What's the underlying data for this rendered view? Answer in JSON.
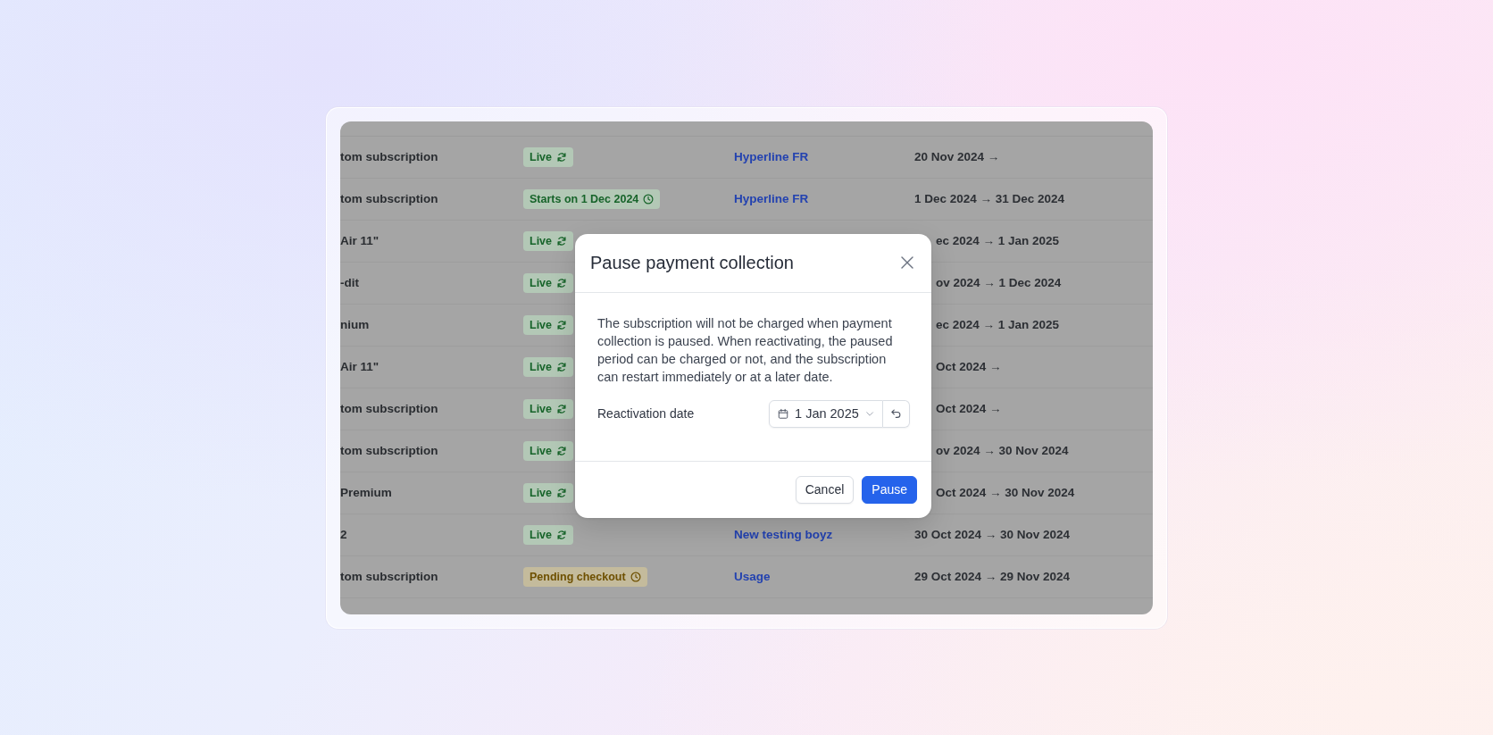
{
  "subscriptions_table": {
    "rows": [
      {
        "column_1": "tom subscription",
        "column_2": {
          "label": "Live",
          "kind": "live"
        },
        "column_3": "Hyperline FR",
        "column_4": "20 Nov 2024 →"
      },
      {
        "column_1": "tom subscription",
        "column_2": {
          "label": "Starts on 1 Dec 2024",
          "kind": "scheduled"
        },
        "column_3": "Hyperline FR",
        "column_4": "1 Dec 2024 → 31 Dec 2024"
      },
      {
        "column_1": "Air 11\"",
        "column_2": {
          "label": "Live",
          "kind": "live"
        },
        "column_4": "ec 2024 → 1 Jan 2025"
      },
      {
        "column_1": "-dit",
        "column_2": {
          "label": "Live",
          "kind": "live"
        },
        "column_4": "ov 2024 → 1 Dec 2024"
      },
      {
        "column_1": "nium",
        "column_2": {
          "label": "Live",
          "kind": "live"
        },
        "column_4": "ec 2024 → 1 Jan 2025"
      },
      {
        "column_1": "Air 11\"",
        "column_2": {
          "label": "Live",
          "kind": "live"
        },
        "column_4": "Oct 2024 →"
      },
      {
        "column_1": "tom subscription",
        "column_2": {
          "label": "Live",
          "kind": "live"
        },
        "column_4": "Oct 2024 →"
      },
      {
        "column_1": "tom subscription",
        "column_2": {
          "label": "Live",
          "kind": "live"
        },
        "column_4": "ov 2024 → 30 Nov 2024"
      },
      {
        "column_1": "Premium",
        "column_2": {
          "label": "Live",
          "kind": "live"
        },
        "column_4": "Oct 2024 → 30 Nov 2024"
      },
      {
        "column_1": "2",
        "column_2": {
          "label": "Live",
          "kind": "live"
        },
        "column_3": "New testing boyz",
        "column_4": "30 Oct 2024 → 30 Nov 2024"
      },
      {
        "column_1": "tom subscription",
        "column_2": {
          "label": "Pending checkout",
          "kind": "pending"
        },
        "column_3": "Usage",
        "column_4": "29 Oct 2024 → 29 Nov 2024"
      }
    ]
  },
  "modal": {
    "title": "Pause payment collection",
    "description": "The subscription will not be charged when payment collection is paused. When reactivating, the paused period can be charged or not, and the subscription can restart immediately or at a later date.",
    "field": {
      "label": "Reactivation date",
      "value": "1 Jan 2025"
    },
    "buttons": [
      {
        "label": "Cancel",
        "kind": "secondary"
      },
      {
        "label": "Pause",
        "kind": "primary"
      }
    ]
  }
}
